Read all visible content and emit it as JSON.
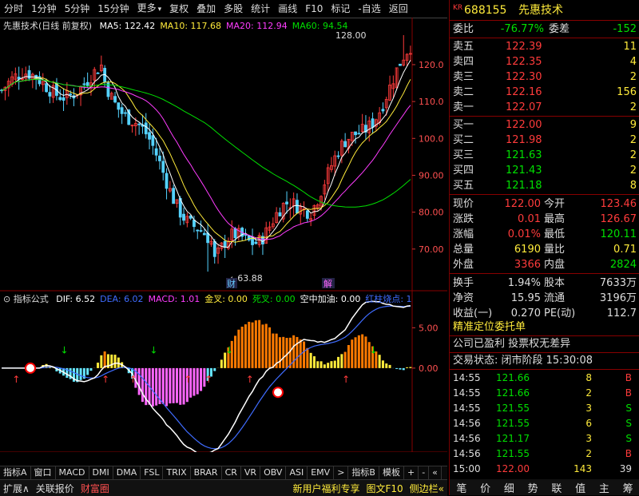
{
  "menu": {
    "items": [
      "分时",
      "1分钟",
      "5分钟",
      "15分钟",
      "更多",
      "复权",
      "叠加",
      "多股",
      "统计",
      "画线",
      "F10",
      "标记",
      "-自选",
      "返回"
    ],
    "more_arrow": "▾"
  },
  "chart": {
    "title": "先惠技术(日线 前复权)",
    "ma": [
      {
        "label": "MA5: 122.42",
        "color": "#ffffff"
      },
      {
        "label": "MA10: 117.68",
        "color": "#ffeb3b"
      },
      {
        "label": "MA20: 112.94",
        "color": "#ff3cff"
      },
      {
        "label": "MA60: 94.54",
        "color": "#00e000"
      }
    ],
    "price_axis": [
      "120.0",
      "110.0",
      "100.0",
      "90.00",
      "80.00",
      "70.00"
    ],
    "high_marker": "128.00",
    "low_marker": "63.88",
    "badges": [
      "财",
      "解"
    ],
    "indicator_title": "指标公式",
    "indicators": [
      {
        "label": "DIF: 6.52",
        "color": "#ffffff"
      },
      {
        "label": "DEA: 6.02",
        "color": "#3f6cff"
      },
      {
        "label": "MACD: 1.01",
        "color": "#ff3cff"
      },
      {
        "label": "金叉: 0.00",
        "color": "#ffeb3b"
      },
      {
        "label": "死叉: 0.00",
        "color": "#00e000"
      },
      {
        "label": "空中加油: 0.00",
        "color": "#ffffff"
      },
      {
        "label": "红柱烧点: 1",
        "color": "#3f6cff"
      }
    ],
    "ind_axis": [
      "5.00",
      "0.00"
    ],
    "date_axis": [
      "2022年",
      "2",
      "3",
      "4",
      "5",
      "6",
      "7"
    ],
    "period": "日线"
  },
  "tabs": [
    "指标A",
    "窗口",
    "MACD",
    "DMI",
    "DMA",
    "FSL",
    "TRIX",
    "BRAR",
    "CR",
    "VR",
    "OBV",
    "ASI",
    "EMV",
    ">",
    "指标B",
    "模板",
    "+",
    "-",
    "«"
  ],
  "status": {
    "left": [
      "扩展∧",
      "关联报价",
      "财富圈"
    ],
    "right": [
      "新用户福利专享",
      "图文F10",
      "侧边栏«"
    ]
  },
  "stock": {
    "code": "688155",
    "name": "先惠技术",
    "prefix": "KR"
  },
  "order_book": {
    "weibi_label": "委比",
    "weibi": "-76.77%",
    "weicha_label": "委差",
    "weicha": "-152",
    "sells": [
      {
        "label": "卖五",
        "price": "122.39",
        "vol": "11"
      },
      {
        "label": "卖四",
        "price": "122.35",
        "vol": "4"
      },
      {
        "label": "卖三",
        "price": "122.30",
        "vol": "2"
      },
      {
        "label": "卖二",
        "price": "122.16",
        "vol": "156"
      },
      {
        "label": "卖一",
        "price": "122.07",
        "vol": "2"
      }
    ],
    "buys": [
      {
        "label": "买一",
        "price": "122.00",
        "vol": "9"
      },
      {
        "label": "买二",
        "price": "121.98",
        "vol": "2"
      },
      {
        "label": "买三",
        "price": "121.63",
        "vol": "2"
      },
      {
        "label": "买四",
        "price": "121.43",
        "vol": "2"
      },
      {
        "label": "买五",
        "price": "121.18",
        "vol": "8"
      }
    ]
  },
  "quote": [
    {
      "l1": "现价",
      "v1": "122.00",
      "c1": "red",
      "l2": "今开",
      "v2": "123.46",
      "c2": "red"
    },
    {
      "l1": "涨跌",
      "v1": "0.01",
      "c1": "red",
      "l2": "最高",
      "v2": "126.67",
      "c2": "red"
    },
    {
      "l1": "涨幅",
      "v1": "0.01%",
      "c1": "red",
      "l2": "最低",
      "v2": "120.11",
      "c2": "green"
    },
    {
      "l1": "总量",
      "v1": "6190",
      "c1": "yellow",
      "l2": "量比",
      "v2": "0.71",
      "c2": "yellow"
    },
    {
      "l1": "外盘",
      "v1": "3366",
      "c1": "red",
      "l2": "内盘",
      "v2": "2824",
      "c2": "green"
    },
    {
      "l1": "换手",
      "v1": "1.94%",
      "c1": "white",
      "l2": "股本",
      "v2": "7633万",
      "c2": "white"
    },
    {
      "l1": "净资",
      "v1": "15.95",
      "c1": "white",
      "l2": "流通",
      "v2": "3196万",
      "c2": "white"
    },
    {
      "l1": "收益(一)",
      "v1": "0.270",
      "c1": "white",
      "l2": "PE(动)",
      "v2": "112.7",
      "c2": "white"
    }
  ],
  "info": {
    "line1": "精准定位委托单",
    "line2": "公司已盈利 投票权无差异",
    "line3": "交易状态: 闭市阶段 15:30:08"
  },
  "trades": [
    {
      "time": "14:55",
      "price": "121.66",
      "vol": "8",
      "side": "B"
    },
    {
      "time": "14:55",
      "price": "121.66",
      "vol": "2",
      "side": "B"
    },
    {
      "time": "14:55",
      "price": "121.55",
      "vol": "3",
      "side": "S"
    },
    {
      "time": "14:56",
      "price": "121.55",
      "vol": "6",
      "side": "S"
    },
    {
      "time": "14:56",
      "price": "121.17",
      "vol": "3",
      "side": "S"
    },
    {
      "time": "14:56",
      "price": "121.55",
      "vol": "2",
      "side": "B"
    },
    {
      "time": "15:00",
      "price": "122.00",
      "vol": "143",
      "side": "39"
    }
  ],
  "bottom_icons": [
    "笔",
    "价",
    "细",
    "势",
    "联",
    "值",
    "主",
    "筹"
  ],
  "colors": {
    "up": "#ff3b3b",
    "down": "#00e000",
    "accent": "#ffeb3b",
    "frame": "#880000"
  }
}
